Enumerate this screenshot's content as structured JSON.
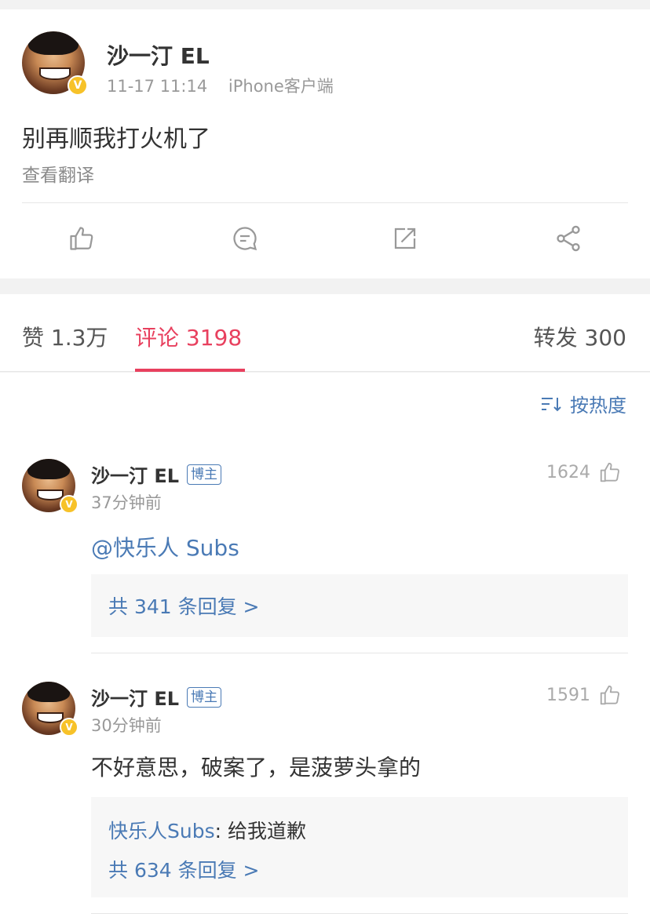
{
  "post": {
    "author": "沙一汀 EL",
    "verified_badge": "V",
    "time": "11-17 11:14",
    "source": "iPhone客户端",
    "text": "别再顺我打火机了",
    "translate_label": "查看翻译",
    "actions": [
      "thumbs-up-icon",
      "comment-icon",
      "repost-icon",
      "share-icon"
    ]
  },
  "tabs": {
    "likes": "赞 1.3万",
    "comments": "评论 3198",
    "reposts": "转发 300"
  },
  "sort": {
    "label": "按热度"
  },
  "comments": [
    {
      "author": "沙一汀 EL",
      "role_badge": "博主",
      "time": "37分钟前",
      "likes": "1624",
      "text": "@快乐人 Subs",
      "reply_count_label": "共 341 条回复 >"
    },
    {
      "author": "沙一汀 EL",
      "role_badge": "博主",
      "time": "30分钟前",
      "likes": "1591",
      "text": "不好意思，破案了，是菠萝头拿的",
      "reply_author": "快乐人Subs",
      "reply_text": ": 给我道歉",
      "reply_count_label": "共 634 条回复 >"
    }
  ],
  "colors": {
    "accent_red": "#e8405e",
    "link_blue": "#4a7ab5",
    "verified_yellow": "#f7c229"
  }
}
